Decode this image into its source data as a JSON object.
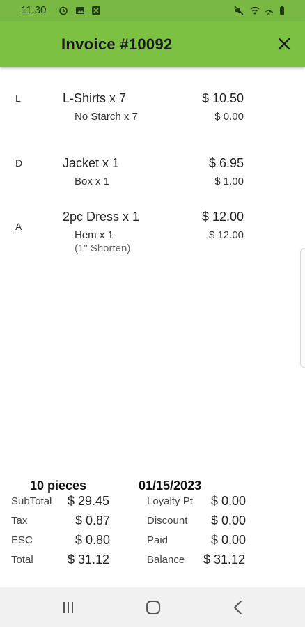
{
  "status_bar": {
    "time": "11:30"
  },
  "header": {
    "title": "Invoice #10092"
  },
  "items": [
    {
      "category": "L",
      "name": "L-Shirts x 7",
      "price": "$ 10.50",
      "sub_name": "No Starch  x 7",
      "sub_price": "$ 0.00",
      "note": ""
    },
    {
      "category": "D",
      "name": "Jacket x 1",
      "price": "$ 6.95",
      "sub_name": "Box  x 1",
      "sub_price": "$ 1.00",
      "note": ""
    },
    {
      "category": "A",
      "name": "2pc Dress x 1",
      "price": "$ 12.00",
      "sub_name": "Hem  x 1",
      "sub_price": "$ 12.00",
      "note": "(1\" Shorten)"
    }
  ],
  "summary": {
    "pieces": "10 pieces",
    "date": "01/15/2023",
    "subtotal_label": "SubTotal",
    "subtotal_value": "$ 29.45",
    "tax_label": "Tax",
    "tax_value": "$ 0.87",
    "esc_label": "ESC",
    "esc_value": "$ 0.80",
    "total_label": "Total",
    "total_value": "$ 31.12",
    "loyalty_label": "Loyalty Pt",
    "loyalty_value": "$ 0.00",
    "discount_label": "Discount",
    "discount_value": "$ 0.00",
    "paid_label": "Paid",
    "paid_value": "$ 0.00",
    "balance_label": "Balance",
    "balance_value": "$ 31.12"
  },
  "colors": {
    "status_bar": "#78b843",
    "app_bar": "#7dc143",
    "nav_bar": "#f1f1f1"
  },
  "icons": [
    "alarm-icon",
    "image-icon",
    "notification-icon",
    "mute-icon",
    "wifi-icon",
    "airplane-icon",
    "battery-icon",
    "close-icon",
    "recent-apps-icon",
    "home-icon",
    "back-icon"
  ]
}
